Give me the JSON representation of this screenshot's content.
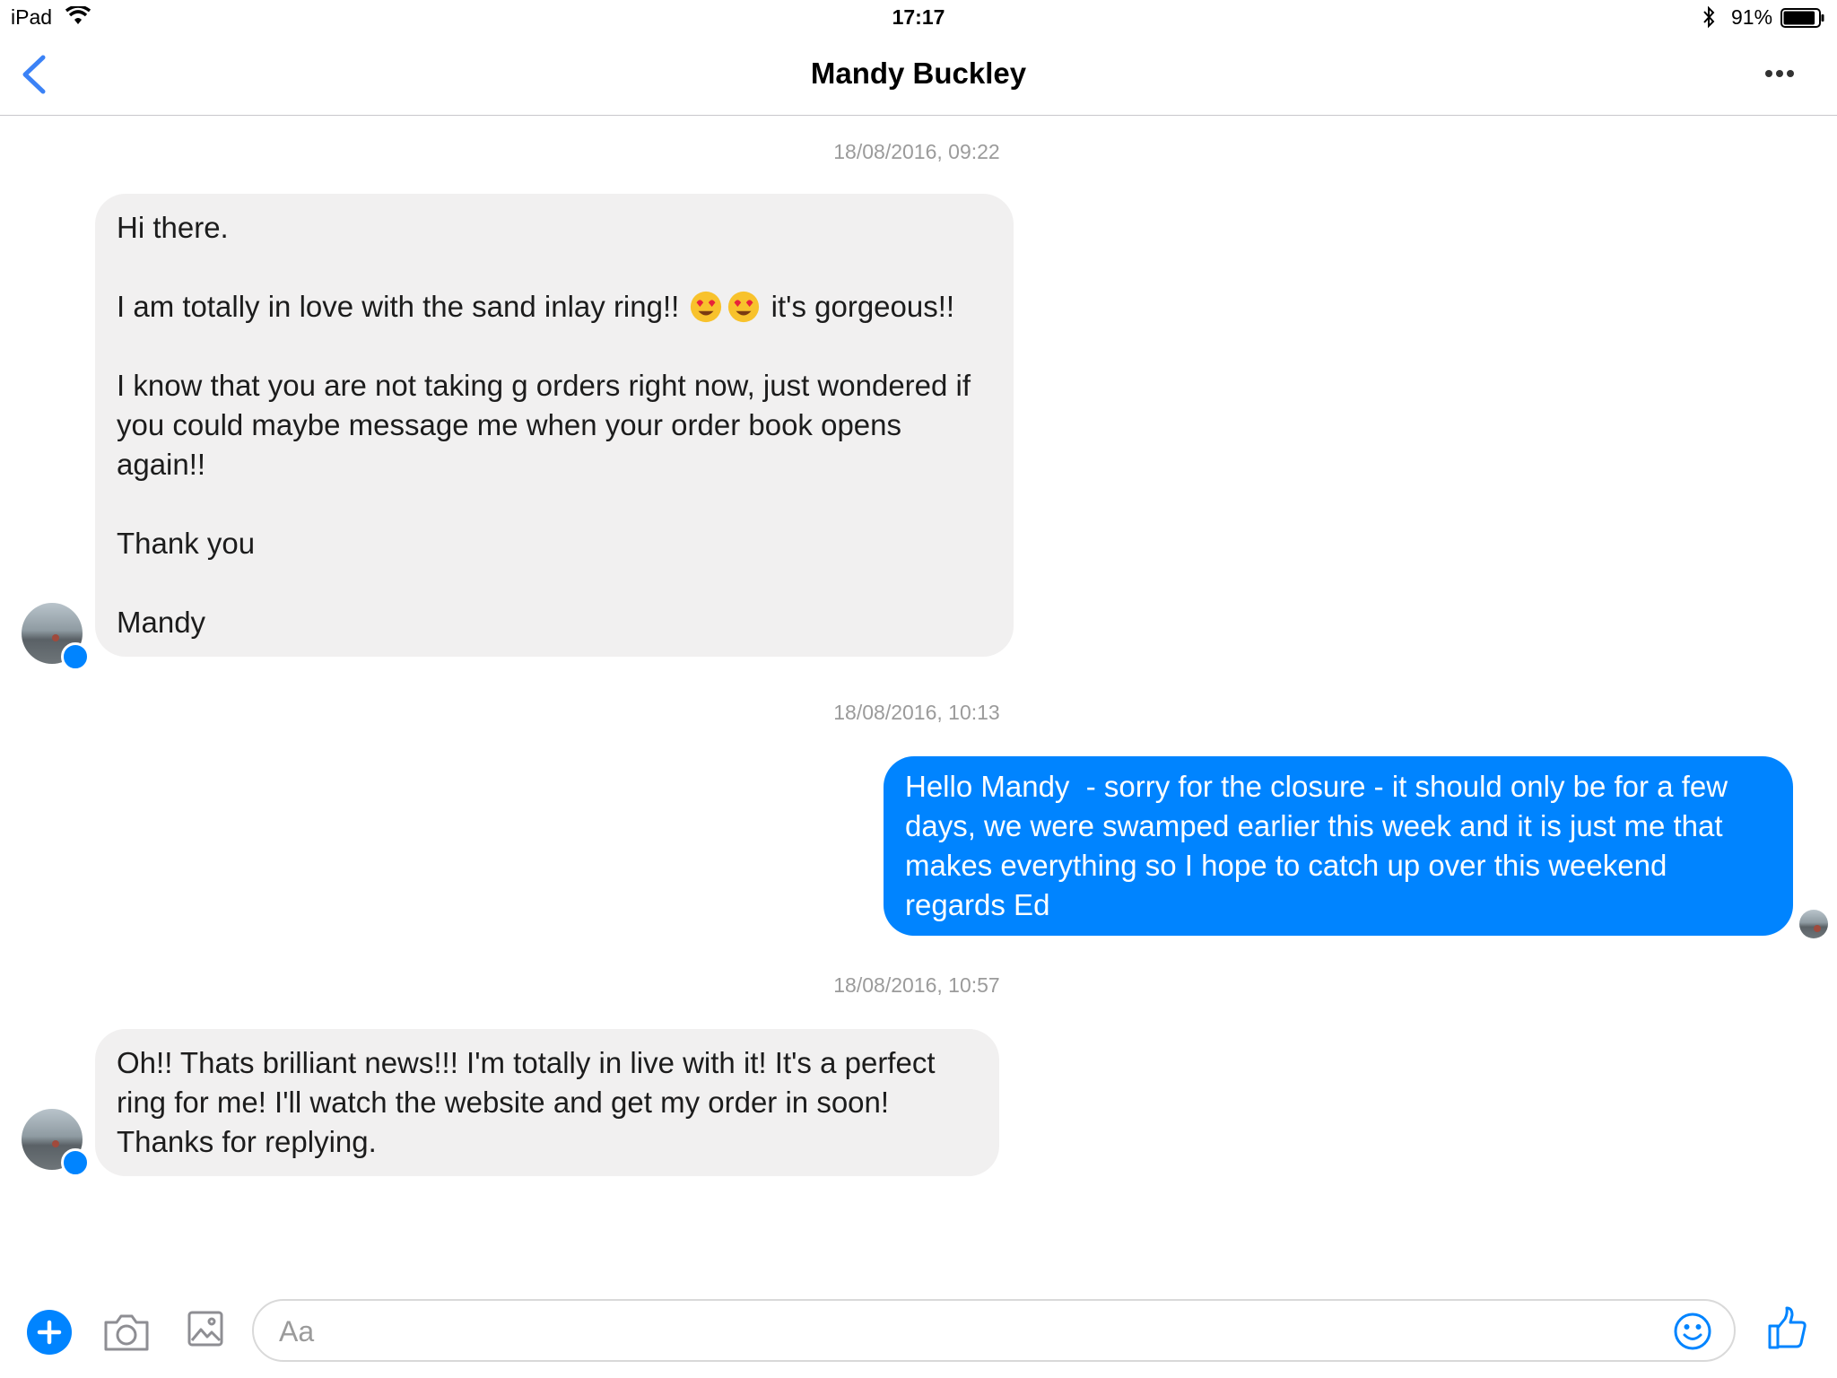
{
  "status_bar": {
    "device": "iPad",
    "time": "17:17",
    "battery": "91%",
    "battery_level": 0.91,
    "wifi_icon": "wifi-icon",
    "bluetooth_icon": "bluetooth-icon"
  },
  "nav": {
    "title": "Mandy Buckley",
    "back_icon": "chevron-left-icon",
    "more_icon": "more-horizontal-icon"
  },
  "thread": [
    {
      "timestamp": "18/08/2016, 09:22"
    },
    {
      "timestamp": "18/08/2016, 10:13"
    },
    {
      "timestamp": "18/08/2016, 10:57"
    }
  ],
  "messages": {
    "m1": {
      "direction": "incoming",
      "line1": "Hi there.",
      "line2_a": "I am totally in love with the sand inlay ring!!",
      "line2_emoji": "heart-eyes-emoji",
      "line2_b": "it's gorgeous!!",
      "line3": "I know that you are not taking g orders right now, just wondered if you could maybe message me when your order book opens again!!",
      "line4": "Thank you",
      "line5": "Mandy"
    },
    "m2": {
      "direction": "outgoing",
      "text": "Hello Mandy  - sorry for the closure - it should only be for a few days, we were swamped earlier this week and it is just me that makes everything so I hope to catch up over this weekend regards Ed"
    },
    "m3": {
      "direction": "incoming",
      "text": "Oh!! Thats brilliant news!!! I'm totally in live with it! It's a perfect ring for me! I'll watch the website and get my order in soon! Thanks for replying."
    }
  },
  "composer": {
    "placeholder": "Aa",
    "value": "",
    "icons": [
      "plus-icon",
      "camera-icon",
      "image-icon",
      "smiley-icon",
      "thumbs-up-icon"
    ]
  },
  "colors": {
    "accent": "#0084ff",
    "incoming_bubble": "#f1f0f0",
    "timestamp": "#9b9b9b"
  }
}
